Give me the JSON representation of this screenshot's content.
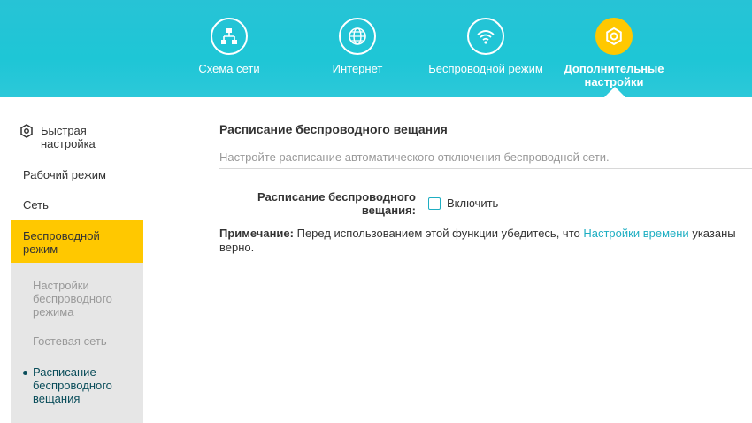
{
  "nav": {
    "items": [
      {
        "label": "Схема сети",
        "icon": "network-map-icon"
      },
      {
        "label": "Интернет",
        "icon": "globe-icon"
      },
      {
        "label": "Беспроводной режим",
        "icon": "wifi-icon"
      },
      {
        "label": "Дополнительные настройки",
        "icon": "gear-icon"
      }
    ],
    "active_index": 3
  },
  "sidebar": {
    "quick": "Быстрая настройка",
    "items": [
      "Рабочий режим",
      "Сеть",
      "Беспроводной режим"
    ],
    "subitems": [
      "Настройки беспроводного режима",
      "Гостевая сеть",
      "Расписание беспроводного вещания"
    ]
  },
  "main": {
    "title": "Расписание беспроводного вещания",
    "description": "Настройте расписание автоматического отключения беспроводной сети.",
    "field_label": "Расписание беспроводного вещания:",
    "checkbox_label": "Включить",
    "note_prefix": "Примечание:",
    "note_text1": " Перед использованием этой функции убедитесь, что ",
    "note_link": "Настройки времени",
    "note_text2": " указаны верно."
  },
  "colors": {
    "header": "#1ec6d6",
    "accent": "#ffc800",
    "link": "#1eaec2"
  }
}
